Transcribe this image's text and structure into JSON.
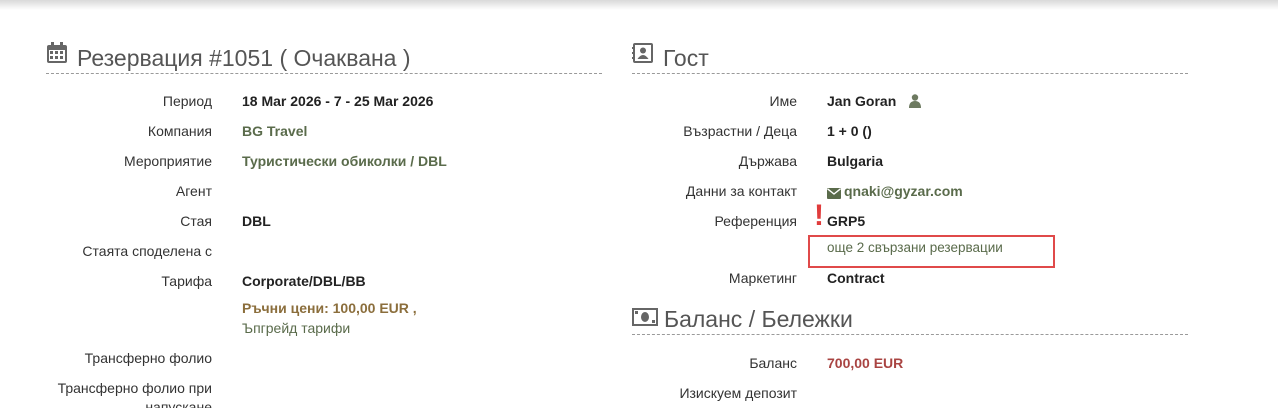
{
  "reservation": {
    "title": "Резервация #1051 ( Очаквана )",
    "fields": {
      "period_label": "Период",
      "period_value": "18 Mar 2026 - 7 - 25 Mar 2026",
      "company_label": "Компания",
      "company_value": "BG Travel",
      "event_label": "Мероприятие",
      "event_value": "Туристически обиколки / DBL",
      "agent_label": "Агент",
      "room_label": "Стая",
      "room_value": "DBL",
      "shared_label": "Стаята споделена с",
      "rate_label": "Тарифа",
      "rate_value": "Corporate/DBL/BB",
      "manual_prices": "Ръчни цени: 100,00 EUR ,",
      "upgrade_rates": "Ъпгрейд тарифи",
      "transfer_folio_label": "Трансферно фолио",
      "transfer_folio_release_label": "Трансферно фолио при",
      "transfer_folio_release_label2": "напускане"
    }
  },
  "guest": {
    "title": "Гост",
    "fields": {
      "name_label": "Име",
      "name_value": "Jan Goran",
      "ages_label": "Възрастни / Деца",
      "ages_value": "1 + 0 ()",
      "country_label": "Държава",
      "country_value": "Bulgaria",
      "contact_label": "Данни за контакт",
      "contact_value": "qnaki@gyzar.com",
      "reference_label": "Референция",
      "reference_value": "GRP5",
      "related_link": "още 2 свързани резервации",
      "marketing_label": "Маркетинг",
      "marketing_value": "Contract"
    }
  },
  "balance": {
    "title": "Баланс / Бележки",
    "fields": {
      "balance_label": "Баланс",
      "balance_value": "700,00 EUR",
      "deposit_label": "Изискуем депозит"
    }
  },
  "icons": {
    "reservation": "calendar-icon",
    "guest": "contact-card-icon",
    "balance": "money-icon",
    "user": "user-icon",
    "email": "envelope-icon",
    "alert": "exclamation-icon"
  },
  "colors": {
    "accent_green": "#5a6b4b",
    "price_gold": "#8b6e3c",
    "balance_red": "#a94442",
    "highlight_box": "#e04a4a"
  }
}
